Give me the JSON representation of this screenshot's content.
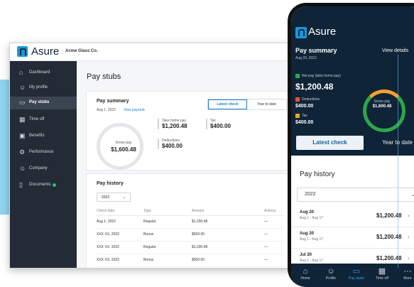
{
  "brand": {
    "name": "Asure",
    "accent": "#1b97d8",
    "dark": "#0f2437"
  },
  "desktop": {
    "company": "Acme Glass Co.",
    "sidebar": [
      {
        "label": "Dashboard",
        "icon": "home-icon"
      },
      {
        "label": "My profile",
        "icon": "user-icon"
      },
      {
        "label": "Pay stubs",
        "icon": "paystub-icon",
        "active": true
      },
      {
        "label": "Time off",
        "icon": "calendar-icon"
      },
      {
        "label": "Benefits",
        "icon": "benefits-icon"
      },
      {
        "label": "Performance",
        "icon": "performance-icon"
      },
      {
        "label": "Company",
        "icon": "company-icon"
      },
      {
        "label": "Documents",
        "icon": "document-icon"
      }
    ],
    "page_title": "Pay stubs",
    "summary": {
      "title": "Pay summary",
      "date": "Aug 1, 2022",
      "view_link": "View paystub",
      "tab_latest": "Latest check",
      "tab_ytd": "Year to date",
      "gross_label": "Gross pay",
      "gross_value": "$1,600.48",
      "take_home_label": "Take home pay",
      "take_home_value": "$1,200.48",
      "tax_label": "Tax",
      "tax_value": "$400.00",
      "deductions_label": "Deductions",
      "deductions_value": "$400.00"
    },
    "history": {
      "title": "Pay history",
      "year": "2022",
      "headers": [
        "Check date",
        "Type",
        "Amount",
        "Actions"
      ],
      "rows": [
        {
          "date": "Aug 1, 2022",
          "type": "Regular",
          "amount": "$1,200.48",
          "action": "—"
        },
        {
          "date": "XXX XX, 2022",
          "type": "Bonus",
          "amount": "$500.00",
          "action": "—"
        },
        {
          "date": "XXX XX, 2022",
          "type": "Regular",
          "amount": "$1,200.48",
          "action": "—"
        },
        {
          "date": "XXX XX, 2022",
          "type": "Bonus",
          "amount": "$500.00",
          "action": "—"
        }
      ]
    }
  },
  "mobile": {
    "title": "Pay summary",
    "view_details": "View details",
    "date": "Aug 20, 2022",
    "net_label": "Net pay (take home pay)",
    "net_value": "$1,200.48",
    "deductions_label": "Deductions",
    "deductions_value": "$400.00",
    "tax_label": "Tax",
    "tax_value": "$400.00",
    "gross_label": "Gross pay",
    "gross_value": "$1,600.48",
    "tab_latest": "Latest check",
    "tab_ytd": "Year to date",
    "history_title": "Pay history",
    "year": "2022",
    "rows": [
      {
        "date": "Aug 20",
        "range": "Aug 1 - Aug 17",
        "amount": "$1,200.48"
      },
      {
        "date": "Aug 20",
        "range": "Aug 1 - Aug 17",
        "amount": "$1,200.48"
      },
      {
        "date": "Jul 20",
        "range": "Aug 1 - Aug 17",
        "amount": "$1,200.48"
      }
    ],
    "nav": [
      {
        "label": "Home",
        "icon": "home-icon"
      },
      {
        "label": "Profile",
        "icon": "user-icon"
      },
      {
        "label": "Pay stubs",
        "icon": "paystub-icon",
        "active": true
      },
      {
        "label": "Time off",
        "icon": "calendar-icon"
      },
      {
        "label": "More",
        "icon": "more-icon"
      }
    ]
  }
}
